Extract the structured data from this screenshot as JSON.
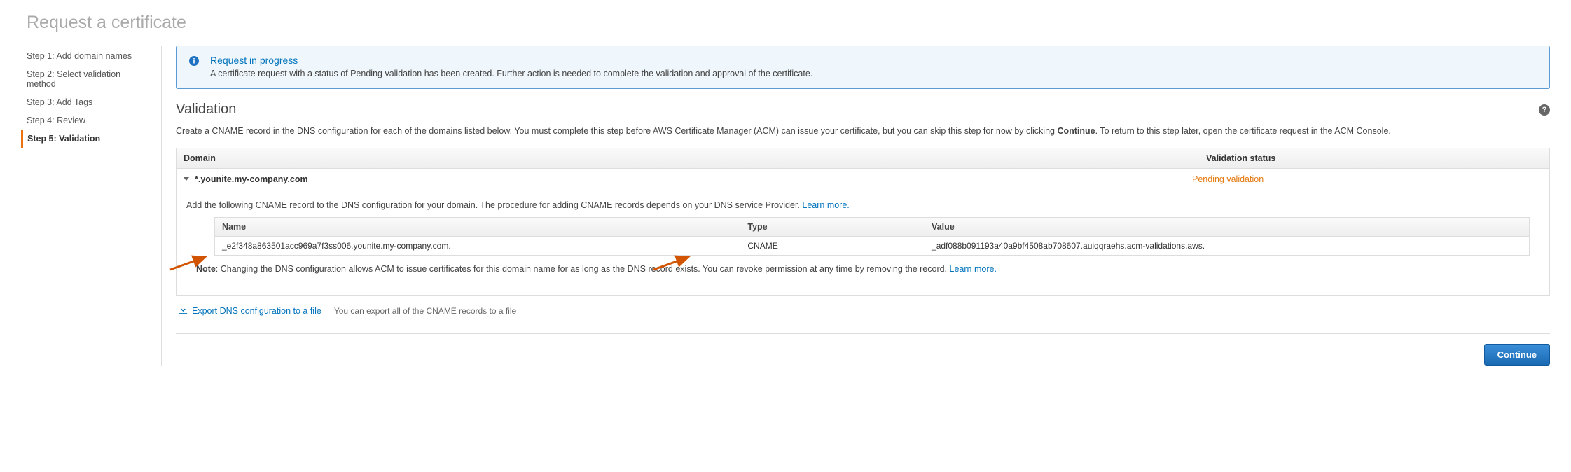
{
  "page_title": "Request a certificate",
  "sidebar": {
    "steps": [
      {
        "label": "Step 1: Add domain names"
      },
      {
        "label": "Step 2: Select validation method"
      },
      {
        "label": "Step 3: Add Tags"
      },
      {
        "label": "Step 4: Review"
      },
      {
        "label": "Step 5: Validation"
      }
    ],
    "active_index": 4
  },
  "notice": {
    "title": "Request in progress",
    "text": "A certificate request with a status of Pending validation has been created. Further action is needed to complete the validation and approval of the certificate."
  },
  "section": {
    "title": "Validation",
    "intro_before": "Create a CNAME record in the DNS configuration for each of the domains listed below. You must complete this step before AWS Certificate Manager (ACM) can issue your certificate, but you can skip this step for now by clicking ",
    "intro_bold": "Continue",
    "intro_after": ". To return to this step later, open the certificate request in the ACM Console."
  },
  "table": {
    "header_domain": "Domain",
    "header_status": "Validation status",
    "row": {
      "domain": "*.younite.my-company.com",
      "status": "Pending validation"
    }
  },
  "detail": {
    "text_before": "Add the following CNAME record to the DNS configuration for your domain. The procedure for adding CNAME records depends on your DNS service Provider. ",
    "learn_more": "Learn more.",
    "inner_headers": {
      "name": "Name",
      "type": "Type",
      "value": "Value"
    },
    "inner_row": {
      "name": "_e2f348a863501acc969a7f3ss006.younite.my-company.com.",
      "type": "CNAME",
      "value": "_adf088b091193a40a9bf4508ab708607.auiqqraehs.acm-validations.aws."
    }
  },
  "note": {
    "bold": "Note",
    "text_before": ": Changing the DNS configuration allows ACM to issue certificates for this domain name for as long as the DNS record exists. You can revoke permission at any time by removing the record. ",
    "learn_more": "Learn more."
  },
  "export": {
    "link": "Export DNS configuration to a file",
    "hint": "You can export all of the CNAME records to a file"
  },
  "footer": {
    "continue_label": "Continue"
  }
}
